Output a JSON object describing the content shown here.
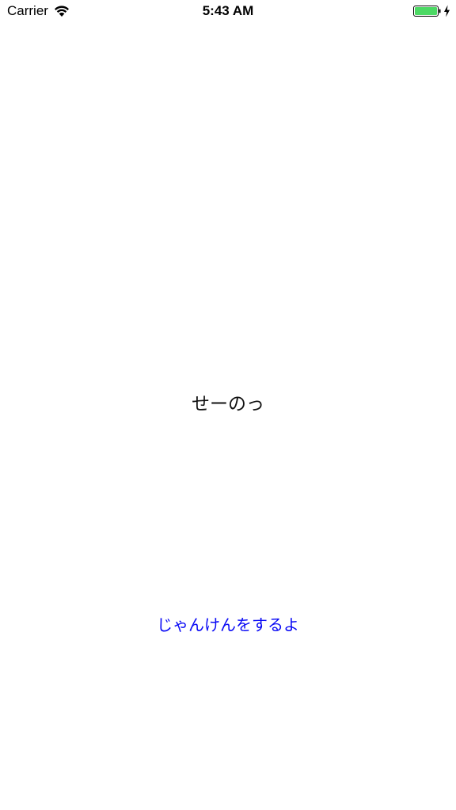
{
  "status_bar": {
    "carrier": "Carrier",
    "time": "5:43 AM",
    "icons": {
      "wifi": "wifi-icon",
      "battery": "battery-icon",
      "charging": "charging-bolt-icon"
    },
    "battery_color": "#4cd964"
  },
  "main": {
    "result_text": "せーのっ",
    "button_label": "じゃんけんをするよ",
    "button_color": "#0a0af5"
  }
}
